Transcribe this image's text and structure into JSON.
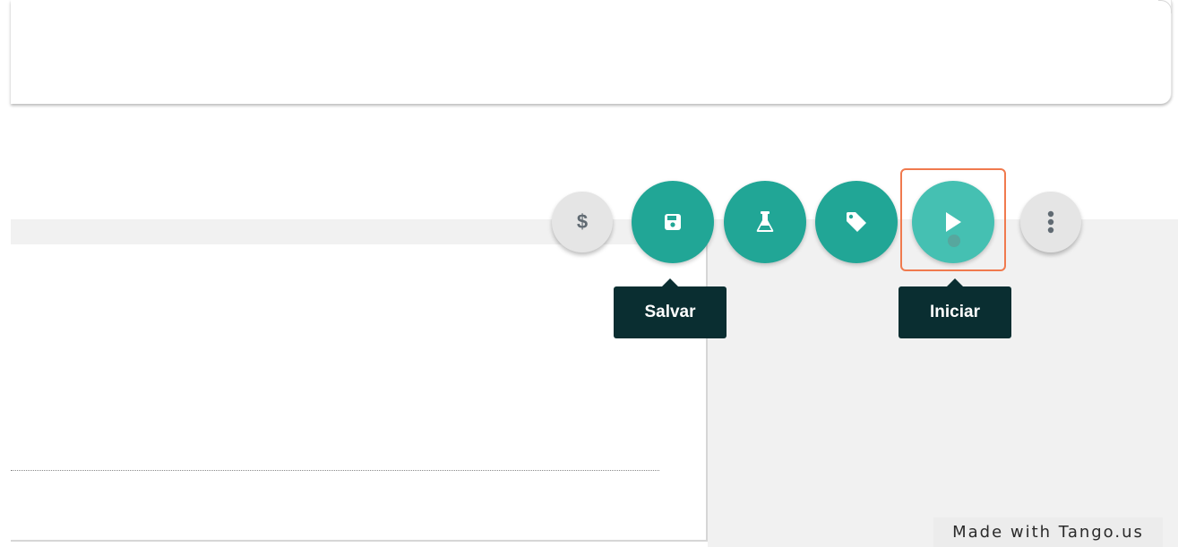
{
  "toolbar": {
    "cost_button": {
      "icon": "dollar-icon",
      "glyph": "$"
    },
    "save_button": {
      "icon": "save-icon"
    },
    "test_button": {
      "icon": "flask-icon"
    },
    "tag_button": {
      "icon": "tag-icon"
    },
    "start_button": {
      "icon": "play-icon"
    },
    "more_button": {
      "icon": "more-vertical-icon"
    }
  },
  "tooltips": {
    "save": "Salvar",
    "start": "Iniciar"
  },
  "watermark": "Made with Tango.us",
  "colors": {
    "teal": "#21a696",
    "teal_active": "#45c0b2",
    "tooltip_bg": "#0a2e31",
    "highlight": "#f07a4e"
  }
}
